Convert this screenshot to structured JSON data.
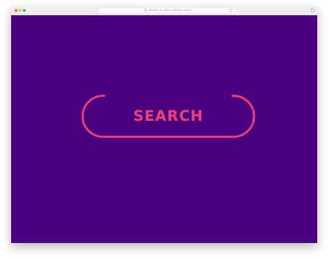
{
  "browser": {
    "address_placeholder": "Search or enter website name"
  },
  "search": {
    "label": "SEARCH",
    "accent_color": "#ee3f76",
    "background_color": "#4b0082"
  }
}
